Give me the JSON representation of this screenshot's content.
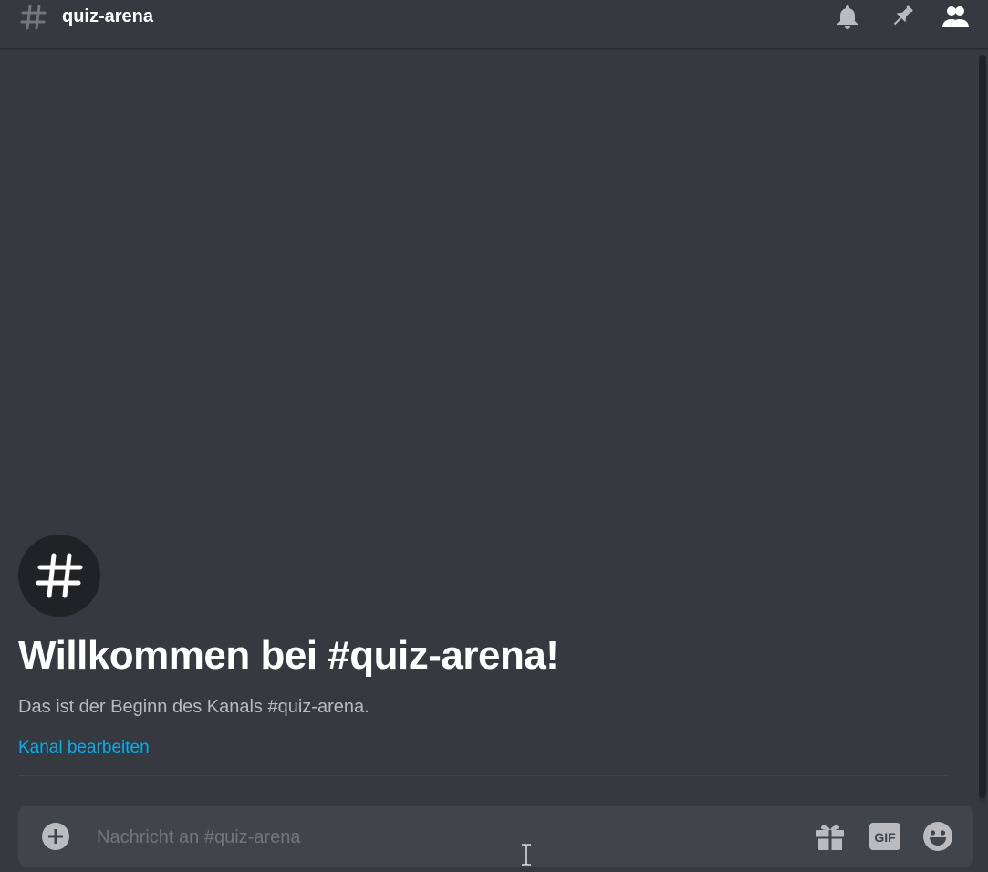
{
  "header": {
    "channel_name": "quiz-arena",
    "icons": [
      "hash-icon",
      "bell-icon",
      "pin-icon",
      "members-icon"
    ]
  },
  "welcome": {
    "title": "Willkommen bei #quiz-arena!",
    "subtitle": "Das ist der Beginn des Kanals #quiz-arena.",
    "edit_link": "Kanal bearbeiten",
    "icon": "hash-icon"
  },
  "composer": {
    "placeholder": "Nachricht an #quiz-arena",
    "value": "",
    "buttons": [
      "add-icon",
      "gift-icon",
      "gif-icon",
      "emoji-icon"
    ],
    "gif_label": "GIF"
  },
  "colors": {
    "background": "#36393f",
    "composer": "#40444b",
    "link": "#00b0f4",
    "title": "#ffffff",
    "muted": "#b9bbbe",
    "icon": "#b9bbbe"
  }
}
